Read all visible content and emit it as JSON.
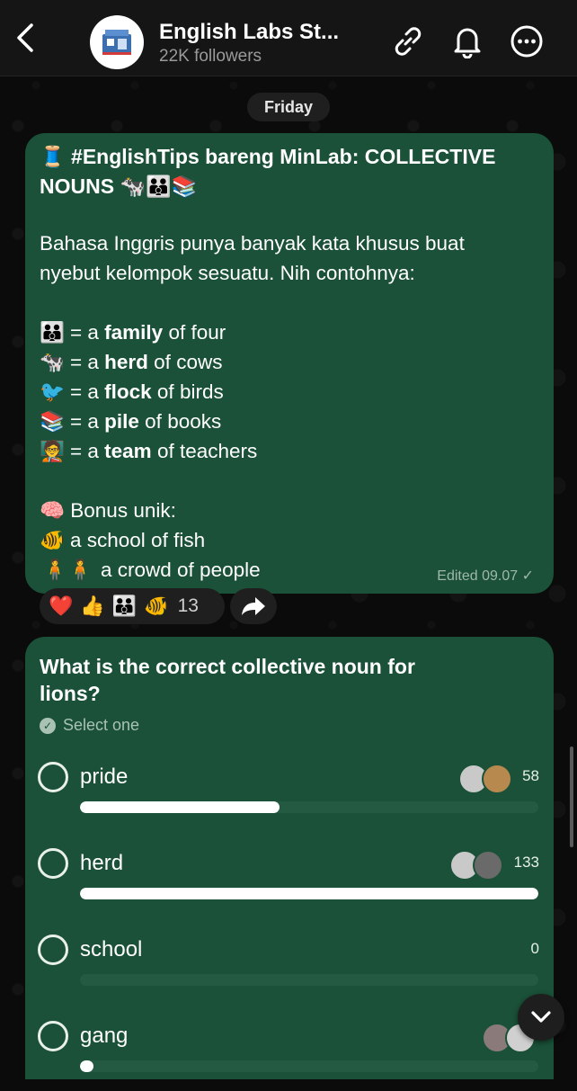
{
  "header": {
    "channel_name": "English Labs St...",
    "followers": "22K followers",
    "back_icon": "chevron-left-icon",
    "link_icon": "link-icon",
    "bell_icon": "bell-icon",
    "more_icon": "more-icon"
  },
  "date_divider": "Friday",
  "message": {
    "title": "🧵 #EnglishTips bareng MinLab: COLLECTIVE NOUNS 🐄👪📚",
    "intro_1": "Bahasa Inggris punya banyak kata khusus buat",
    "intro_2": "nyebut kelompok sesuatu. Nih contohnya:",
    "examples": [
      {
        "emoji": "👪",
        "pre": "= a ",
        "noun": "family",
        "post": " of four"
      },
      {
        "emoji": "🐄",
        "pre": "= a ",
        "noun": "herd",
        "post": " of cows"
      },
      {
        "emoji": "🐦",
        "pre": "= a ",
        "noun": "flock",
        "post": " of birds"
      },
      {
        "emoji": "📚",
        "pre": "= a ",
        "noun": "pile",
        "post": " of books"
      },
      {
        "emoji": "🧑‍🏫",
        "pre": "= a ",
        "noun": "team",
        "post": " of teachers"
      }
    ],
    "bonus_title": "🧠 Bonus unik:",
    "bonus_items": [
      {
        "emoji": "🐠",
        "text": "a school of fish"
      },
      {
        "emoji": "🧍🧍",
        "text": "a crowd of people"
      }
    ],
    "meta": "Edited 09.07 ✓"
  },
  "reactions": {
    "emojis": [
      "❤️",
      "👍",
      "👪",
      "🐠"
    ],
    "count": "13",
    "share_icon": "share-arrow-icon"
  },
  "poll": {
    "question": "What is the correct collective noun for lions?",
    "instruction": "Select one",
    "options": [
      {
        "label": "pride",
        "count": "58",
        "fraction": 0.436
      },
      {
        "label": "herd",
        "count": "133",
        "fraction": 1.0
      },
      {
        "label": "school",
        "count": "0",
        "fraction": 0.0
      },
      {
        "label": "gang",
        "count": "",
        "fraction": 0.03
      }
    ]
  },
  "scroll_down_icon": "chevron-down-icon",
  "colors": {
    "bubble": "#1a5138",
    "background": "#0b0b0b",
    "header": "#151515",
    "reaction_pill": "#1f1f1f"
  }
}
